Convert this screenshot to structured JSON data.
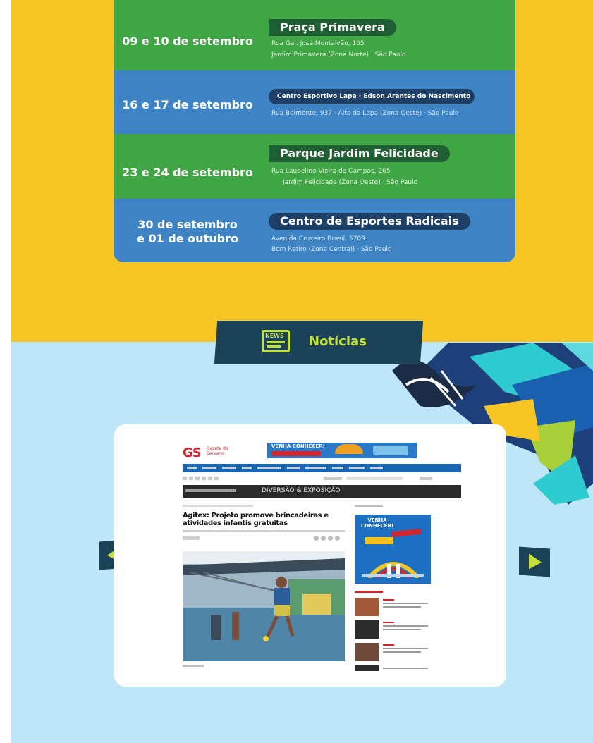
{
  "schedule": {
    "rows": [
      {
        "date": "09 e 10 de setembro",
        "title": "Praça Primavera",
        "addr1": "Rua Gal. José Montalvão, 165",
        "addr2": "Jardim Primavera (Zona Norte) · São Paulo"
      },
      {
        "date": "16 e 17 de setembro",
        "title": "Centro Esportivo Lapa · Edson Arantes do Nascimento",
        "addr1": "Rua Belmonte, 937 · Alto da Lapa (Zona Oeste) · São Paulo",
        "addr2": ""
      },
      {
        "date": "23 e 24 de setembro",
        "title": "Parque Jardim Felicidade",
        "addr1": "Rua Laudelino Vieira de Campos, 265",
        "addr2": "Jardim Felicidade (Zona Oeste) · São Paulo"
      },
      {
        "date_line1": "30 de setembro",
        "date_line2": "e 01 de outubro",
        "title": "Centro de Esportes Radicais",
        "addr1": "Avenida Cruzeiro Brasil, 5709",
        "addr2": "Bom Retiro (Zona Central) · São Paulo"
      }
    ]
  },
  "news": {
    "label": "Notícias",
    "icon_text": "NEWS"
  },
  "screenshot": {
    "logo_letters": "GS",
    "logo_sub_line1": "Gazeta do",
    "logo_sub_line2": "Servano",
    "ad_text": "VENHA CONHECER!",
    "section_title": "DIVERSÃO & EXPOSIÇÃO",
    "article_title": "Agitex: Projeto promove brincadeiras e atividades infantis gratuitas",
    "side_ad_text": "VENHA CONHECER!"
  },
  "colors": {
    "yellow": "#f7c624",
    "light_blue": "#bfe6f7",
    "green_row": "#3fa545",
    "blue_row": "#3e84c4",
    "accent_lime": "#c4e235",
    "navy": "#1c4257"
  }
}
